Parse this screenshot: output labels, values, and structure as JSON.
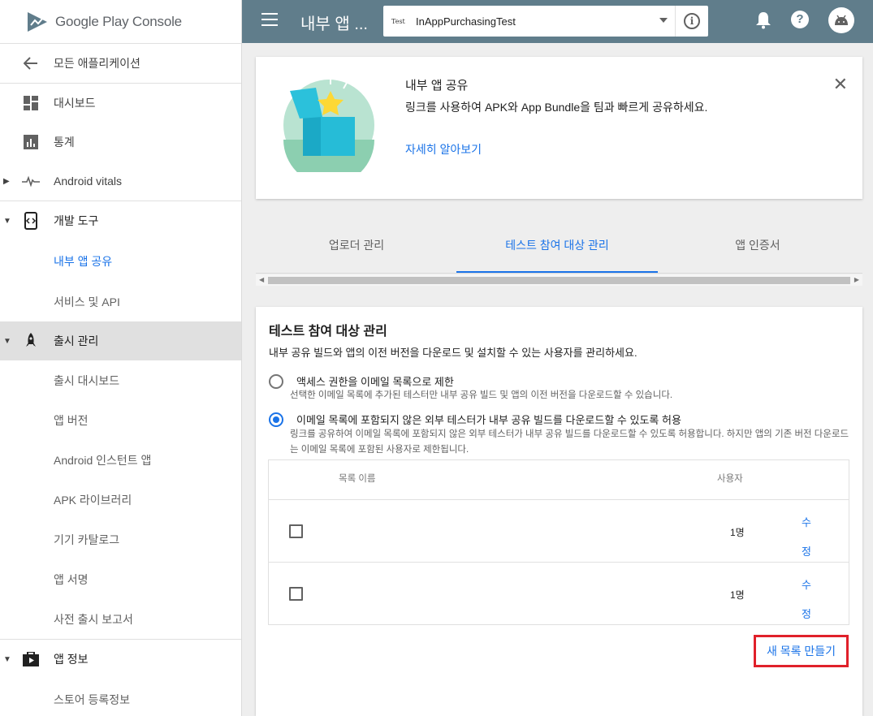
{
  "app": {
    "logo_text": "Google Play Console"
  },
  "sidebar": {
    "back_label": "모든 애플리케이션",
    "items": [
      {
        "label": "대시보드"
      },
      {
        "label": "통계"
      },
      {
        "label": "Android vitals"
      },
      {
        "label": "개발 도구"
      },
      {
        "label": "내부 앱 공유"
      },
      {
        "label": "서비스 및 API"
      },
      {
        "label": "출시 관리"
      },
      {
        "label": "출시 대시보드"
      },
      {
        "label": "앱 버전"
      },
      {
        "label": "Android 인스턴트 앱"
      },
      {
        "label": "APK 라이브러리"
      },
      {
        "label": "기기 카탈로그"
      },
      {
        "label": "앱 서명"
      },
      {
        "label": "사전 출시 보고서"
      },
      {
        "label": "앱 정보"
      },
      {
        "label": "스토어 등록정보"
      }
    ]
  },
  "topbar": {
    "title": "내부 앱 ...",
    "app_thumb": "Test",
    "app_name": "InAppPurchasingTest"
  },
  "promo": {
    "title": "내부 앱 공유",
    "description": "링크를 사용하여 APK와 App Bundle을 팀과 빠르게 공유하세요.",
    "link": "자세히 알아보기"
  },
  "tabs": [
    {
      "label": "업로더 관리"
    },
    {
      "label": "테스트 참여 대상 관리"
    },
    {
      "label": "앱 인증서"
    }
  ],
  "audience": {
    "title": "테스트 참여 대상 관리",
    "description": "내부 공유 빌드와 앱의 이전 버전을 다운로드 및 설치할 수 있는 사용자를 관리하세요.",
    "option1": {
      "label": "액세스 권한을 이메일 목록으로 제한",
      "sub": "선택한 이메일 목록에 추가된 테스터만 내부 공유 빌드 및 앱의 이전 버전을 다운로드할 수 있습니다."
    },
    "option2": {
      "label": "이메일 목록에 포함되지 않은 외부 테스터가 내부 공유 빌드를 다운로드할 수 있도록 허용",
      "sub": "링크를 공유하여 이메일 목록에 포함되지 않은 외부 테스터가 내부 공유 빌드를 다운로드할 수 있도록 허용합니다. 하지만 앱의 기존 버전 다운로드는 이메일 목록에 포함된 사용자로 제한됩니다."
    },
    "table": {
      "col_name": "목록 이름",
      "col_users": "사용자",
      "rows": [
        {
          "users": "1명",
          "edit": "수정"
        },
        {
          "users": "1명",
          "edit": "수정"
        }
      ]
    },
    "new_list_button": "새 목록 만들기"
  },
  "colors": {
    "topbar": "#607d8b",
    "accent": "#1a73e8",
    "highlight_box": "#e0202a"
  }
}
